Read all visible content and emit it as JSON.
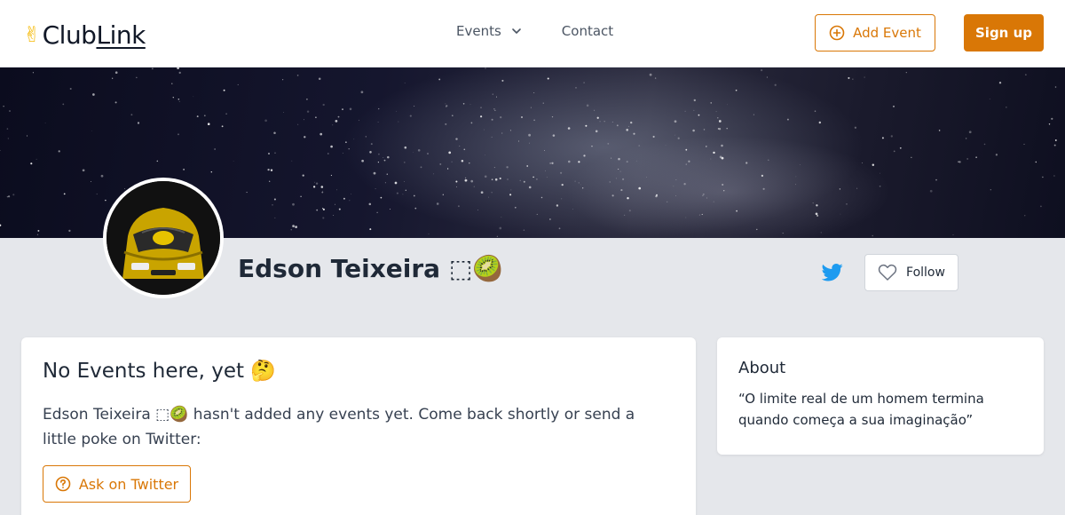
{
  "header": {
    "logo_prefix": "Club",
    "logo_suffix": "Link",
    "nav": {
      "events_label": "Events",
      "contact_label": "Contact"
    },
    "add_event_label": "Add Event",
    "signup_label": "Sign up"
  },
  "profile": {
    "name": "Edson Teixeira ⬚🥝",
    "follow_label": "Follow"
  },
  "events_card": {
    "title": "No Events here, yet 🤔",
    "message": "Edson Teixeira ⬚🥝 hasn't added any events yet. Come back shortly or send a little poke on Twitter:",
    "ask_label": "Ask on Twitter"
  },
  "about_card": {
    "title": "About",
    "text": "“O limite real de um homem termina quando começa a sua imaginação”"
  },
  "colors": {
    "accent": "#d97706",
    "twitter": "#1d9bf0",
    "page_bg": "#e5e7eb"
  }
}
